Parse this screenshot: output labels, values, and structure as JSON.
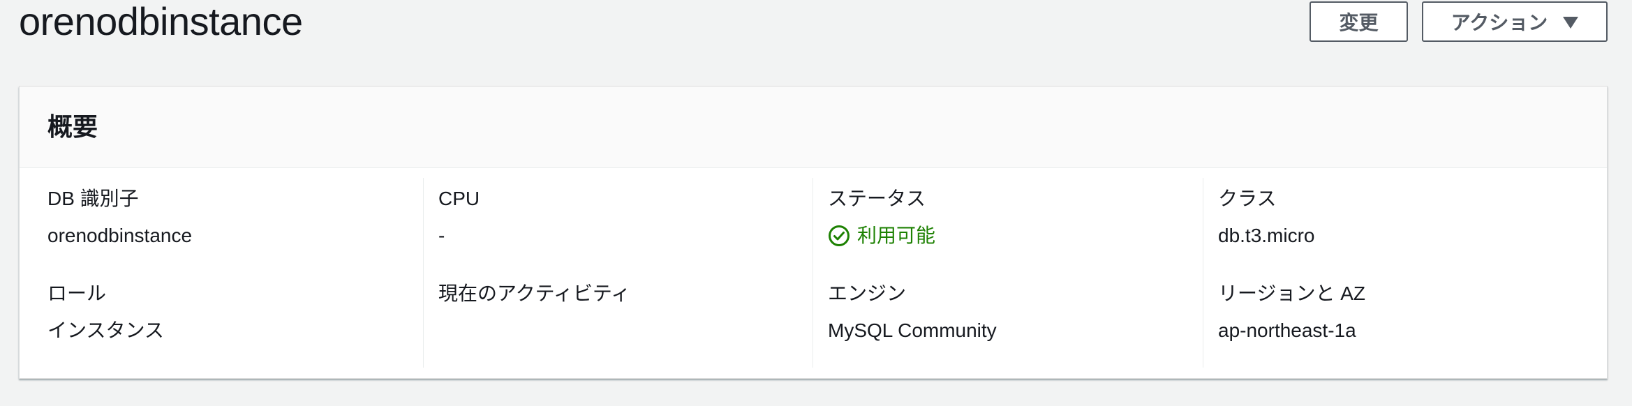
{
  "header": {
    "title": "orenodbinstance",
    "modify_label": "変更",
    "actions_label": "アクション"
  },
  "summary": {
    "title": "概要",
    "fields": {
      "db_identifier": {
        "label": "DB 識別子",
        "value": "orenodbinstance"
      },
      "role": {
        "label": "ロール",
        "value": "インスタンス"
      },
      "cpu": {
        "label": "CPU",
        "value": "-"
      },
      "current_activity": {
        "label": "現在のアクティビティ",
        "value": ""
      },
      "status": {
        "label": "ステータス",
        "value": "利用可能",
        "icon": "check-circle-icon",
        "color": "#1d8102"
      },
      "engine": {
        "label": "エンジン",
        "value": "MySQL Community"
      },
      "class": {
        "label": "クラス",
        "value": "db.t3.micro"
      },
      "region_az": {
        "label": "リージョンと AZ",
        "value": "ap-northeast-1a"
      }
    }
  }
}
